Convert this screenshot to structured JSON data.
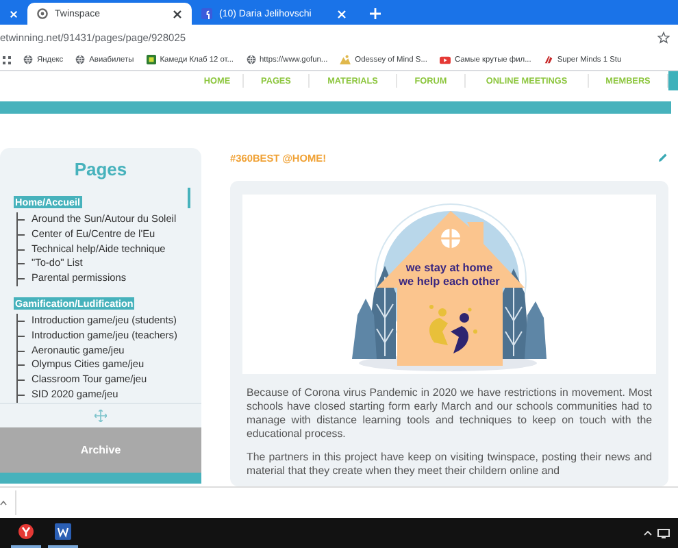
{
  "browser": {
    "tabs": [
      {
        "selected": false
      },
      {
        "title": "Twinspace",
        "selected": true
      },
      {
        "title": "(10) Daria Jelihovschi",
        "selected": false
      }
    ],
    "address": "etwinning.net/91431/pages/page/928025",
    "bookmarks": [
      {
        "title": "Яндекс",
        "kind": "globe"
      },
      {
        "title": "Авиабилеты",
        "kind": "globe"
      },
      {
        "title": "Камеди Клаб 12 от...",
        "kind": "tv"
      },
      {
        "title": "https://www.gofun...",
        "kind": "globe"
      },
      {
        "title": "Odessey of Mind S...",
        "kind": "image"
      },
      {
        "title": "Самые крутые фил...",
        "kind": "video"
      },
      {
        "title": "Super Minds 1 Stu",
        "kind": "book"
      }
    ]
  },
  "site_nav": [
    {
      "label": "HOME",
      "selected": false
    },
    {
      "label": "PAGES",
      "selected": false
    },
    {
      "label": "MATERIALS",
      "selected": false
    },
    {
      "label": "FORUM",
      "selected": false
    },
    {
      "label": "ONLINE MEETINGS",
      "selected": false
    },
    {
      "label": "MEMBERS",
      "selected": false
    }
  ],
  "sidebar": {
    "title": "Pages",
    "pages": [
      {
        "label": "Home/Accueil",
        "children": [
          {
            "label": "Around the Sun/Autour du Soleil"
          },
          {
            "label": "Center of Eu/Centre de l'Eu"
          },
          {
            "label": "Technical help/Aide technique"
          },
          {
            "label": "\"To-do\" List"
          },
          {
            "label": "Parental permissions"
          }
        ]
      },
      {
        "label": "Gamification/Ludification",
        "children": [
          {
            "label": "Introduction game/jeu (students)"
          },
          {
            "label": "Introduction game/jeu (teachers)"
          },
          {
            "label": "Aeronautic game/jeu"
          },
          {
            "label": "Olympus Cities game/jeu"
          },
          {
            "label": "Classroom Tour game/jeu"
          },
          {
            "label": "SID 2020 game/jeu"
          }
        ]
      }
    ],
    "archive_button": "Archive"
  },
  "article": {
    "title": "#360BEST @HOME!",
    "illustration": {
      "lines": [
        "we stay at home",
        "we help each other"
      ]
    },
    "paragraphs": [
      "Because of Corona virus Pandemic in 2020 we have restrictions in movement. Most schools have closed starting form early March and our schools communities had to manage with distance learning tools and techniques to keep on touch with the educational process.",
      "The partners in this project have keep on visiting twinspace, posting their news and material that they create when they meet their childern online and"
    ]
  },
  "taskbar": {
    "apps": [
      {
        "kind": "browser"
      },
      {
        "kind": "word"
      }
    ]
  }
}
